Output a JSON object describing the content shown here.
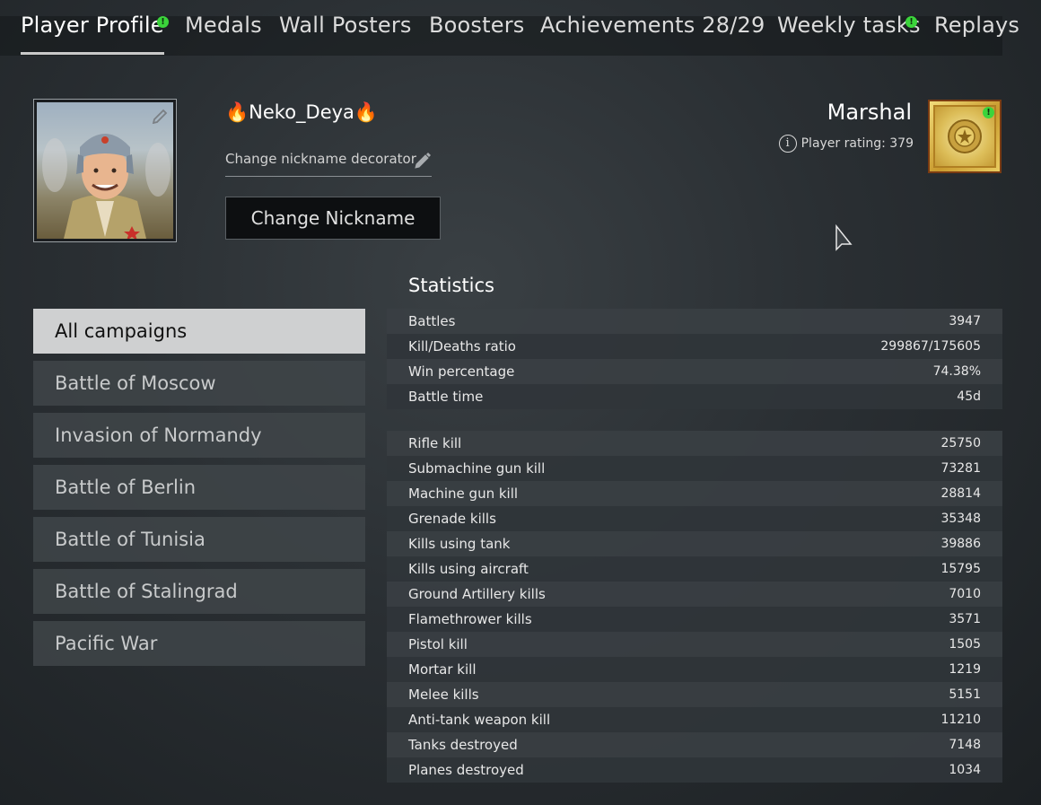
{
  "tabs": [
    {
      "label": "Player Profile",
      "active": true,
      "notification": true
    },
    {
      "label": "Medals"
    },
    {
      "label": "Wall Posters"
    },
    {
      "label": "Boosters"
    },
    {
      "label": "Achievements 28/29"
    },
    {
      "label": "Weekly tasks",
      "notification": true
    },
    {
      "label": "Replays"
    }
  ],
  "profile": {
    "nickname": "🔥Neko_Deya🔥",
    "decorator_label": "Change nickname decorator",
    "change_nickname_label": "Change Nickname",
    "rank": "Marshal",
    "rating_label": "Player rating: 379",
    "notification_glyph": "!"
  },
  "campaigns": [
    {
      "label": "All campaigns",
      "active": true
    },
    {
      "label": "Battle of Moscow"
    },
    {
      "label": "Invasion of Normandy"
    },
    {
      "label": "Battle of Berlin"
    },
    {
      "label": "Battle of Tunisia"
    },
    {
      "label": "Battle of Stalingrad"
    },
    {
      "label": "Pacific War"
    }
  ],
  "statistics": {
    "title": "Statistics",
    "general": [
      {
        "label": "Battles",
        "value": "3947"
      },
      {
        "label": "Kill/Deaths ratio",
        "value": "299867/175605"
      },
      {
        "label": "Win percentage",
        "value": "74.38%"
      },
      {
        "label": "Battle time",
        "value": "45d"
      }
    ],
    "kills": [
      {
        "label": "Rifle kill",
        "value": "25750"
      },
      {
        "label": "Submachine gun kill",
        "value": "73281"
      },
      {
        "label": "Machine gun kill",
        "value": "28814"
      },
      {
        "label": "Grenade kills",
        "value": "35348"
      },
      {
        "label": "Kills using tank",
        "value": "39886"
      },
      {
        "label": "Kills using aircraft",
        "value": "15795"
      },
      {
        "label": "Ground Artillery kills",
        "value": "7010"
      },
      {
        "label": "Flamethrower kills",
        "value": "3571"
      },
      {
        "label": "Pistol kill",
        "value": "1505"
      },
      {
        "label": "Mortar kill",
        "value": "1219"
      },
      {
        "label": "Melee kills",
        "value": "5151"
      },
      {
        "label": "Anti-tank weapon kill",
        "value": "11210"
      },
      {
        "label": "Tanks destroyed",
        "value": "7148"
      },
      {
        "label": "Planes destroyed",
        "value": "1034"
      }
    ]
  },
  "icons": {
    "edit": "pencil-icon",
    "info": "info-icon",
    "rank_badge": "marshal-rank-icon",
    "cursor": "mouse-cursor-icon"
  },
  "colors": {
    "notification": "#3bd43b",
    "active_campaign_bg": "#cfd0d1",
    "rank_badge_gold": "#dcbd58"
  }
}
